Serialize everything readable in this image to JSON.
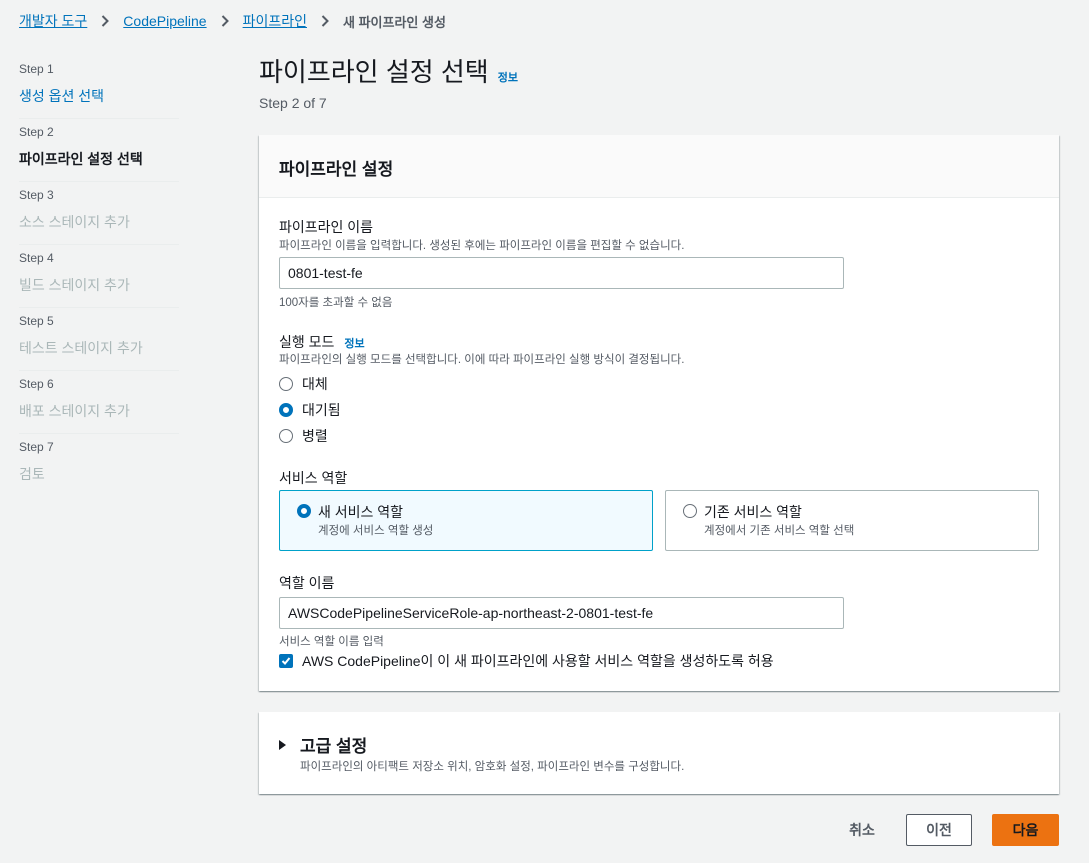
{
  "breadcrumb": {
    "items": [
      "개발자 도구",
      "CodePipeline",
      "파이프라인"
    ],
    "current": "새 파이프라인 생성"
  },
  "steps": [
    {
      "num": "Step 1",
      "title": "생성 옵션 선택",
      "state": "link"
    },
    {
      "num": "Step 2",
      "title": "파이프라인 설정 선택",
      "state": "current"
    },
    {
      "num": "Step 3",
      "title": "소스 스테이지 추가",
      "state": "disabled"
    },
    {
      "num": "Step 4",
      "title": "빌드 스테이지 추가",
      "state": "disabled"
    },
    {
      "num": "Step 5",
      "title": "테스트 스테이지 추가",
      "state": "disabled"
    },
    {
      "num": "Step 6",
      "title": "배포 스테이지 추가",
      "state": "disabled"
    },
    {
      "num": "Step 7",
      "title": "검토",
      "state": "disabled"
    }
  ],
  "page": {
    "title": "파이프라인 설정 선택",
    "info": "정보",
    "step_of": "Step 2 of 7"
  },
  "settings": {
    "header": "파이프라인 설정",
    "pipeline_name": {
      "label": "파이프라인 이름",
      "description": "파이프라인 이름을 입력합니다. 생성된 후에는 파이프라인 이름을 편집할 수 없습니다.",
      "value": "0801-test-fe",
      "constraint": "100자를 초과할 수 없음"
    },
    "execution_mode": {
      "label": "실행 모드",
      "info": "정보",
      "description": "파이프라인의 실행 모드를 선택합니다. 이에 따라 파이프라인 실행 방식이 결정됩니다.",
      "options": [
        "대체",
        "대기됨",
        "병렬"
      ],
      "selected": "대기됨"
    },
    "service_role": {
      "label": "서비스 역할",
      "new": {
        "title": "새 서비스 역할",
        "desc": "계정에 서비스 역할 생성"
      },
      "existing": {
        "title": "기존 서비스 역할",
        "desc": "계정에서 기존 서비스 역할 선택"
      },
      "selected": "new"
    },
    "role_name": {
      "label": "역할 이름",
      "value": "AWSCodePipelineServiceRole-ap-northeast-2-0801-test-fe",
      "constraint": "서비스 역할 이름 입력"
    },
    "allow_checkbox": {
      "label": "AWS CodePipeline이 이 새 파이프라인에 사용할 서비스 역할을 생성하도록 허용",
      "checked": true
    }
  },
  "advanced": {
    "title": "고급 설정",
    "description": "파이프라인의 아티팩트 저장소 위치, 암호화 설정, 파이프라인 변수를 구성합니다."
  },
  "footer": {
    "cancel": "취소",
    "previous": "이전",
    "next": "다음"
  },
  "colors": {
    "link": "#0073bb",
    "primary_button": "#ec7211",
    "selected_tile_bg": "#f1faff"
  }
}
